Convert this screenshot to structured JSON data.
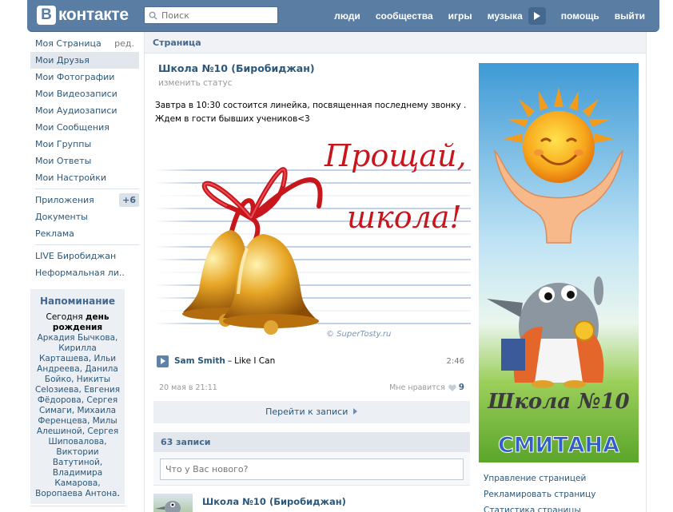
{
  "header": {
    "logo_text": "контакте",
    "logo_letter": "В",
    "search_placeholder": "Поиск",
    "nav": [
      "люди",
      "сообщества",
      "игры",
      "музыка",
      "помощь",
      "выйти"
    ]
  },
  "sidebar": {
    "items": [
      {
        "label": "Моя Страница",
        "extra": "ред."
      },
      {
        "label": "Мои Друзья"
      },
      {
        "label": "Мои Фотографии"
      },
      {
        "label": "Мои Видеозаписи"
      },
      {
        "label": "Мои Аудиозаписи"
      },
      {
        "label": "Мои Сообщения"
      },
      {
        "label": "Мои Группы"
      },
      {
        "label": "Мои Ответы"
      },
      {
        "label": "Мои Настройки"
      }
    ],
    "apps": {
      "label": "Приложения",
      "badge": "+6"
    },
    "items2": [
      {
        "label": "Документы"
      },
      {
        "label": "Реклама"
      }
    ],
    "items3": [
      {
        "label": "LIVE Биробиджан"
      },
      {
        "label": "Неформальная ли.."
      }
    ]
  },
  "reminder": {
    "title": "Напоминание",
    "prefix": "Сегодня ",
    "bold": "день рождения",
    "names": " Аркадия Бычкова, Кирилла Карташева, Ильи Андреева, Данила Бойко, Никиты Celозиева, Евгения Фёдорова, Сергея Симаги, Михаила Ференцева, Милы Алешиной, Сергея Шиповалова, Виктории Ватутиной, Владимира Камарова, Воропаева Антона",
    "suffix": "."
  },
  "page": {
    "heading": "Страница",
    "group_name": "Школа №10 (Биробиджан)",
    "change_status": "изменить статус",
    "post_text": "Завтра в 10:30 состоится линейка, посвященная последнему звонку . Ждем в гости бывших учеников<3",
    "image_caption_1": "Прощай,",
    "image_caption_2": "школа!",
    "image_watermark": "© SuperTosty.ru",
    "audio": {
      "artist": "Sam Smith",
      "dash": " – ",
      "title": "Like I Can",
      "duration": "2:46"
    },
    "post_date": "20 мая в 21:11",
    "like_label": "Мне нравится",
    "like_count": "9",
    "go_to_post": "Перейти к записи",
    "wall_count": "63 записи",
    "post_placeholder": "Что у Вас нового?",
    "wall_author": "Школа №10 (Биробиджан)"
  },
  "avatar": {
    "title": "Школа №10",
    "subtitle": "СМИТАНА"
  },
  "right_links": [
    "Управление страницей",
    "Рекламировать страницу",
    "Статистика страницы"
  ]
}
